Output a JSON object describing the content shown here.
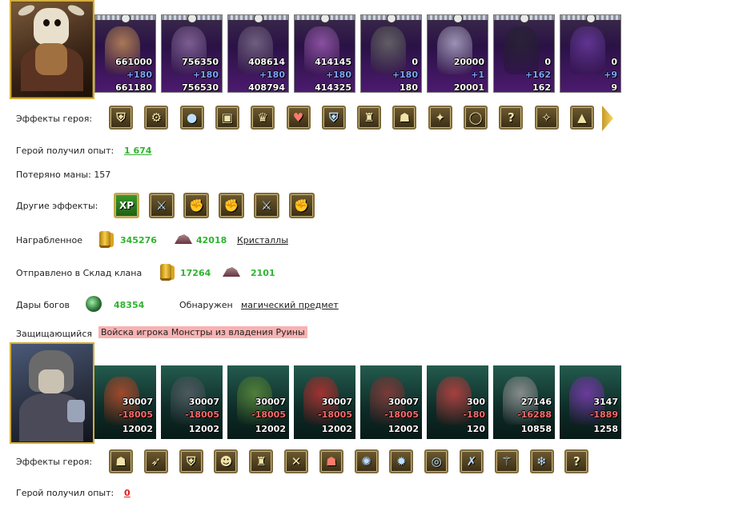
{
  "attacker": {
    "portrait": "hero-portrait-skull-helm",
    "troops": [
      {
        "n1": "661000",
        "n2": "+180",
        "n3": "661180",
        "loss": false
      },
      {
        "n1": "756350",
        "n2": "+180",
        "n3": "756530",
        "loss": false
      },
      {
        "n1": "408614",
        "n2": "+180",
        "n3": "408794",
        "loss": false
      },
      {
        "n1": "414145",
        "n2": "+180",
        "n3": "414325",
        "loss": false
      },
      {
        "n1": "0",
        "n2": "+180",
        "n3": "180",
        "loss": false
      },
      {
        "n1": "20000",
        "n2": "+1",
        "n3": "20001",
        "loss": false
      },
      {
        "n1": "0",
        "n2": "+162",
        "n3": "162",
        "loss": false
      },
      {
        "n1": "0",
        "n2": "+9",
        "n3": "9",
        "loss": false
      }
    ],
    "effects_label": "Эффекты героя:",
    "effects": [
      "shield-icon",
      "gears-icon",
      "orb-icon",
      "chest-icon",
      "treasure-icon",
      "heart-icon",
      "shield-blue-icon",
      "armor-icon",
      "helmet-icon",
      "amulet-icon",
      "ring-icon",
      "question-icon",
      "rune-icon",
      "tent-icon"
    ],
    "exp_label": "Герой получил опыт:",
    "exp_value": "1 674",
    "mana_text": "Потеряно маны: 157",
    "other_effects_label": "Другие эффекты:",
    "other_effects": [
      {
        "icon": "xp-icon",
        "text": "XP"
      },
      {
        "icon": "sword-icon",
        "text": "⚔"
      },
      {
        "icon": "fist-sword-icon",
        "text": "✊"
      },
      {
        "icon": "fist-sword-icon",
        "text": "✊"
      },
      {
        "icon": "sword-icon",
        "text": "⚔"
      },
      {
        "icon": "fist-sword-icon",
        "text": "✊"
      }
    ],
    "loot_label": "Награбленное",
    "loot_gold": "345276",
    "loot_ore": "42018",
    "loot_link": "Кристаллы",
    "clan_label": "Отправлено в Склад клана",
    "clan_gold": "17264",
    "clan_ore": "2101",
    "gifts_label": "Дары богов",
    "gifts_value": "48354",
    "found_label": "Обнаружен",
    "found_link": "магический предмет"
  },
  "defender": {
    "label": "Защищающийся",
    "badge": "Войска игрока Монстры из владения Руины",
    "portrait": "hero-portrait-armored-ogre",
    "troops": [
      {
        "n1": "30007",
        "n2": "-18005",
        "n3": "12002",
        "loss": true
      },
      {
        "n1": "30007",
        "n2": "-18005",
        "n3": "12002",
        "loss": true
      },
      {
        "n1": "30007",
        "n2": "-18005",
        "n3": "12002",
        "loss": true
      },
      {
        "n1": "30007",
        "n2": "-18005",
        "n3": "12002",
        "loss": true
      },
      {
        "n1": "30007",
        "n2": "-18005",
        "n3": "12002",
        "loss": true
      },
      {
        "n1": "300",
        "n2": "-180",
        "n3": "120",
        "loss": true
      },
      {
        "n1": "27146",
        "n2": "-16288",
        "n3": "10858",
        "loss": true
      },
      {
        "n1": "3147",
        "n2": "-1889",
        "n3": "1258",
        "loss": true
      }
    ],
    "effects_label": "Эффекты героя:",
    "effects": [
      "helm-gold-icon",
      "arrows-icon",
      "shield-icon",
      "dwarf-icon",
      "armor-icon",
      "crossed-axes-icon",
      "helmet-red-icon",
      "crystal-icon",
      "rune-blue-icon",
      "ring-chain-icon",
      "axes-blue-icon",
      "staff-icon",
      "ice-shard-icon",
      "question-icon"
    ],
    "exp_label": "Герой получил опыт:",
    "exp_value": "0"
  },
  "colors": {
    "gain": "#7ea6ff",
    "loss": "#ff6a6a",
    "green": "#2fb42f",
    "badge": "#f8b2b2"
  }
}
